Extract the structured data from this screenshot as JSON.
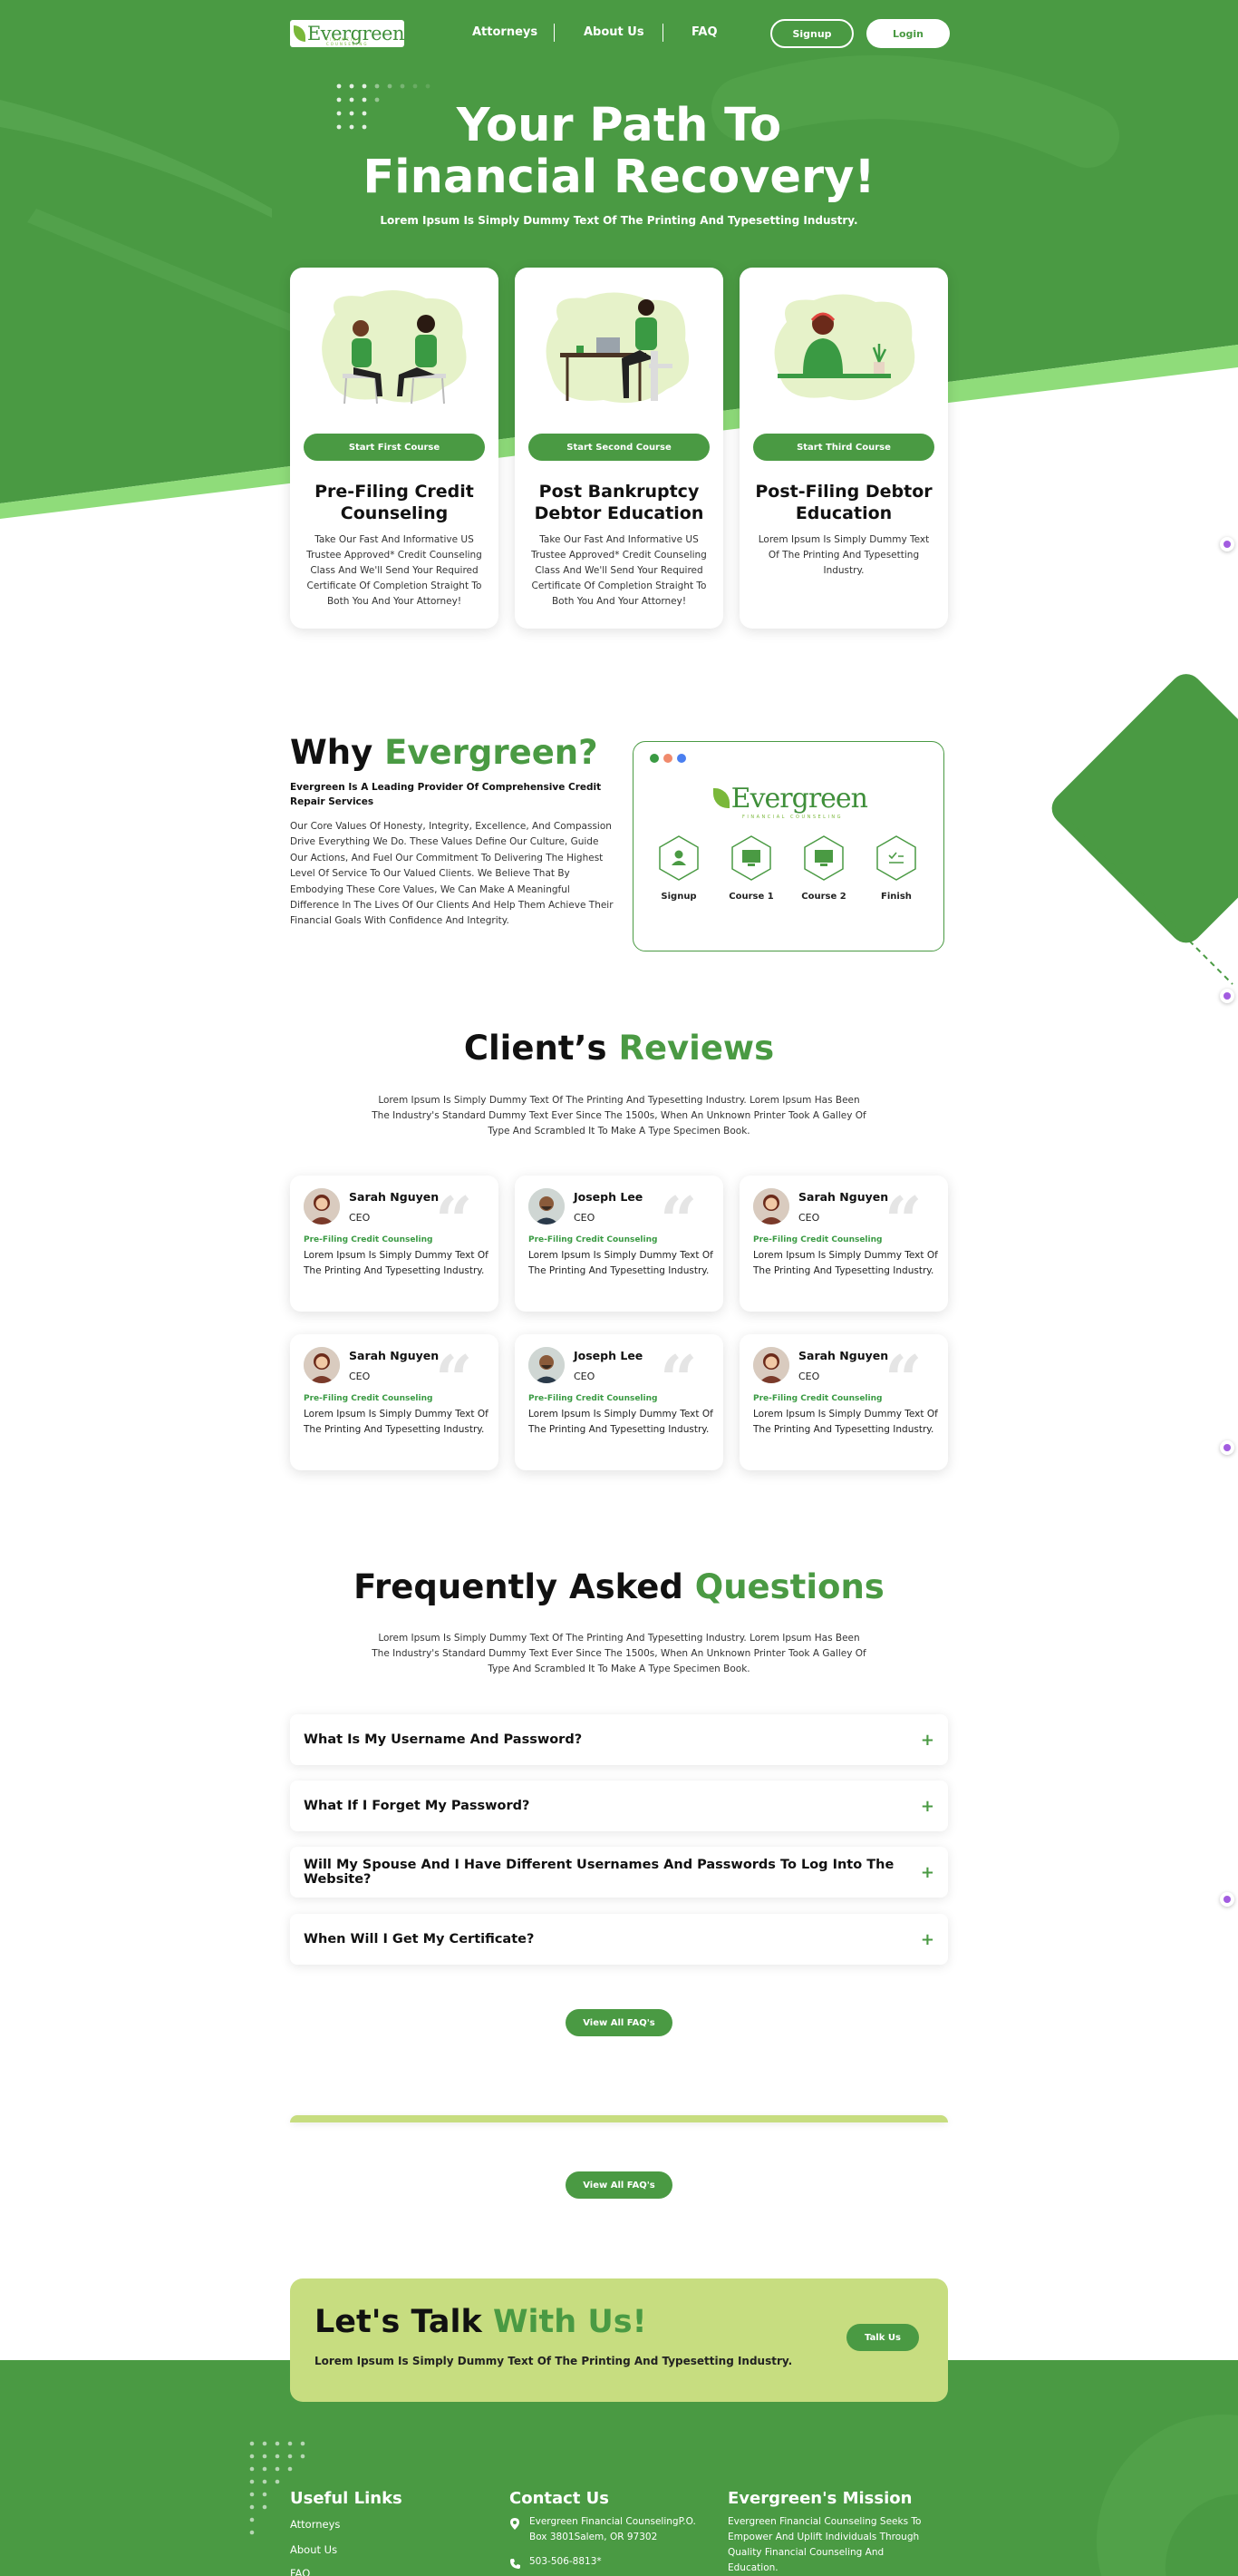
{
  "nav": {
    "logo": "Evergreen",
    "logo_sub": "FINANCIAL COUNSELING",
    "links": [
      "Attorneys",
      "About Us",
      "FAQ"
    ],
    "signup": "Signup",
    "login": "Login"
  },
  "hero": {
    "title": "Your Path To Financial Recovery!",
    "subtitle": "Lorem Ipsum Is Simply Dummy Text Of The Printing And Typesetting Industry."
  },
  "courses": [
    {
      "button": "Start First Course",
      "title": "Pre-Filing Credit Counseling",
      "desc": "Take Our Fast And Informative US Trustee Approved* Credit Counseling Class And We'll Send Your Required Certificate Of Completion Straight To Both You And Your Attorney!"
    },
    {
      "button": "Start Second Course",
      "title": "Post Bankruptcy Debtor Education",
      "desc": "Take Our Fast And Informative US Trustee Approved* Credit Counseling Class And We'll Send Your Required Certificate Of Completion Straight To Both You And Your Attorney!"
    },
    {
      "button": "Start Third Course",
      "title": "Post-Filing Debtor Education",
      "desc": "Lorem Ipsum Is Simply Dummy Text Of The Printing And Typesetting Industry."
    }
  ],
  "why": {
    "title_a": "Why ",
    "title_b": "Evergreen?",
    "subtitle": "Evergreen Is A Leading Provider Of Comprehensive Credit Repair Services",
    "body": "Our Core Values Of Honesty, Integrity, Excellence, And Compassion Drive Everything We Do. These Values Define Our Culture, Guide Our Actions, And Fuel Our Commitment To Delivering The Highest Level Of Service To Our Valued Clients. We Believe That By Embodying These Core Values, We Can Make A Meaningful Difference In The Lives Of Our Clients And Help Them Achieve Their Financial Goals With Confidence And Integrity.",
    "logo": "Evergreen",
    "logo_sub": "FINANCIAL COUNSELING",
    "steps": [
      "Signup",
      "Course 1",
      "Course 2",
      "Finish"
    ],
    "dot_colors": [
      "#3a9a43",
      "#f08a6c",
      "#4a7ff0"
    ]
  },
  "reviews": {
    "title_a": "Client’s ",
    "title_b": "Reviews",
    "desc": "Lorem Ipsum Is Simply Dummy Text Of The Printing And Typesetting Industry. Lorem Ipsum Has Been The Industry's Standard Dummy Text Ever Since The 1500s, When An Unknown Printer Took A Galley Of Type And Scrambled It To Make A Type Specimen Book.",
    "items": [
      {
        "name": "Sarah Nguyen",
        "role": "CEO",
        "tag": "Pre-Filing Credit Counseling",
        "text": "Lorem Ipsum Is Simply Dummy Text Of The Printing And Typesetting Industry."
      },
      {
        "name": "Joseph Lee",
        "role": "CEO",
        "tag": "Pre-Filing Credit Counseling",
        "text": "Lorem Ipsum Is Simply Dummy Text Of The Printing And Typesetting Industry."
      },
      {
        "name": "Sarah Nguyen",
        "role": "CEO",
        "tag": "Pre-Filing Credit Counseling",
        "text": "Lorem Ipsum Is Simply Dummy Text Of The Printing And Typesetting Industry."
      },
      {
        "name": "Sarah Nguyen",
        "role": "CEO",
        "tag": "Pre-Filing Credit Counseling",
        "text": "Lorem Ipsum Is Simply Dummy Text Of The Printing And Typesetting Industry."
      },
      {
        "name": "Joseph Lee",
        "role": "CEO",
        "tag": "Pre-Filing Credit Counseling",
        "text": "Lorem Ipsum Is Simply Dummy Text Of The Printing And Typesetting Industry."
      },
      {
        "name": "Sarah Nguyen",
        "role": "CEO",
        "tag": "Pre-Filing Credit Counseling",
        "text": "Lorem Ipsum Is Simply Dummy Text Of The Printing And Typesetting Industry."
      }
    ]
  },
  "faq": {
    "title_a": "Frequently Asked ",
    "title_b": "Questions",
    "desc": "Lorem Ipsum Is Simply Dummy Text Of The Printing And Typesetting Industry. Lorem Ipsum Has Been The Industry's Standard Dummy Text Ever Since The 1500s, When An Unknown Printer Took A Galley Of Type And Scrambled It To Make A Type Specimen Book.",
    "items": [
      "What Is My Username And Password?",
      "What If I Forget My Password?",
      "Will My Spouse And I Have Different Usernames And Passwords To Log Into The Website?",
      "When Will I Get My Certificate?"
    ],
    "view_all": "View All FAQ's",
    "view_all_2": "View All FAQ's"
  },
  "talk": {
    "title_a": "Let's Talk ",
    "title_b": "With Us!",
    "subtitle": "Lorem Ipsum Is Simply Dummy Text Of The Printing And Typesetting Industry.",
    "button": "Talk Us"
  },
  "footer": {
    "useful_title": "Useful Links",
    "useful_links": [
      "Attorneys",
      "About Us",
      "FAQ"
    ],
    "contact_title": "Contact Us",
    "address": "Evergreen Financial CounselingP.O. Box 3801Salem, OR 97302",
    "phone": "503-506-8813*",
    "mission_title": "Evergreen's Mission",
    "mission": "Evergreen Financial Counseling Seeks To Empower And Uplift Individuals Through Quality Financial Counseling And Education."
  },
  "colors": {
    "brand_green": "#4a9a43",
    "light_green": "#8fdc7a",
    "lime": "#c7dd80"
  }
}
